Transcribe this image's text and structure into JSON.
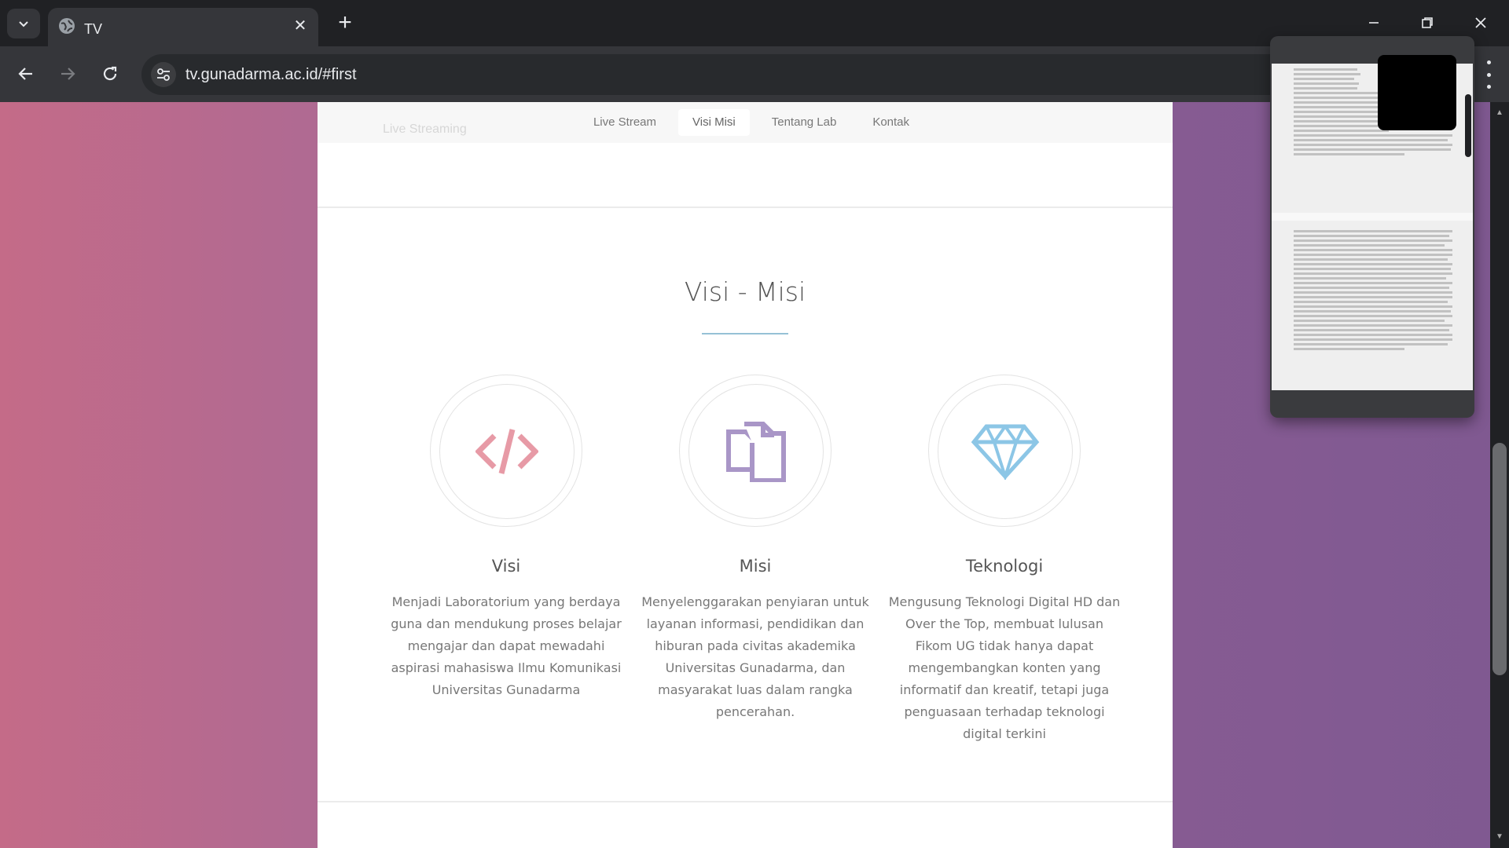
{
  "browser": {
    "tab_title": "TV",
    "url": "tv.gunadarma.ac.id/#first"
  },
  "page": {
    "nav_ghost_text": "Live Streaming",
    "nav": [
      {
        "label": "Live Stream",
        "active": false
      },
      {
        "label": "Visi Misi",
        "active": true
      },
      {
        "label": "Tentang Lab",
        "active": false
      },
      {
        "label": "Kontak",
        "active": false
      }
    ],
    "section_title": "Visi - Misi",
    "features": [
      {
        "icon": "code-icon",
        "icon_color": "#e79aa6",
        "title": "Visi",
        "text": "Menjadi Laboratorium yang berdaya guna dan mendukung proses belajar mengajar dan dapat mewadahi aspirasi mahasiswa Ilmu Komunikasi Universitas Gunadarma"
      },
      {
        "icon": "copy-icon",
        "icon_color": "#a996c7",
        "title": "Misi",
        "text": "Menyelenggarakan penyiaran untuk layanan informasi, pendidikan dan hiburan pada civitas akademika Universitas Gunadarma, dan masyarakat luas dalam rangka pencerahan."
      },
      {
        "icon": "diamond-icon",
        "icon_color": "#8cc6e6",
        "title": "Teknologi",
        "text": "Mengusung Teknologi Digital HD dan Over the Top, membuat lulusan Fikom UG tidak hanya dapat mengembangkan konten yang informatif dan kreatif, tetapi juga penguasaan terhadap teknologi digital terkini"
      }
    ]
  }
}
